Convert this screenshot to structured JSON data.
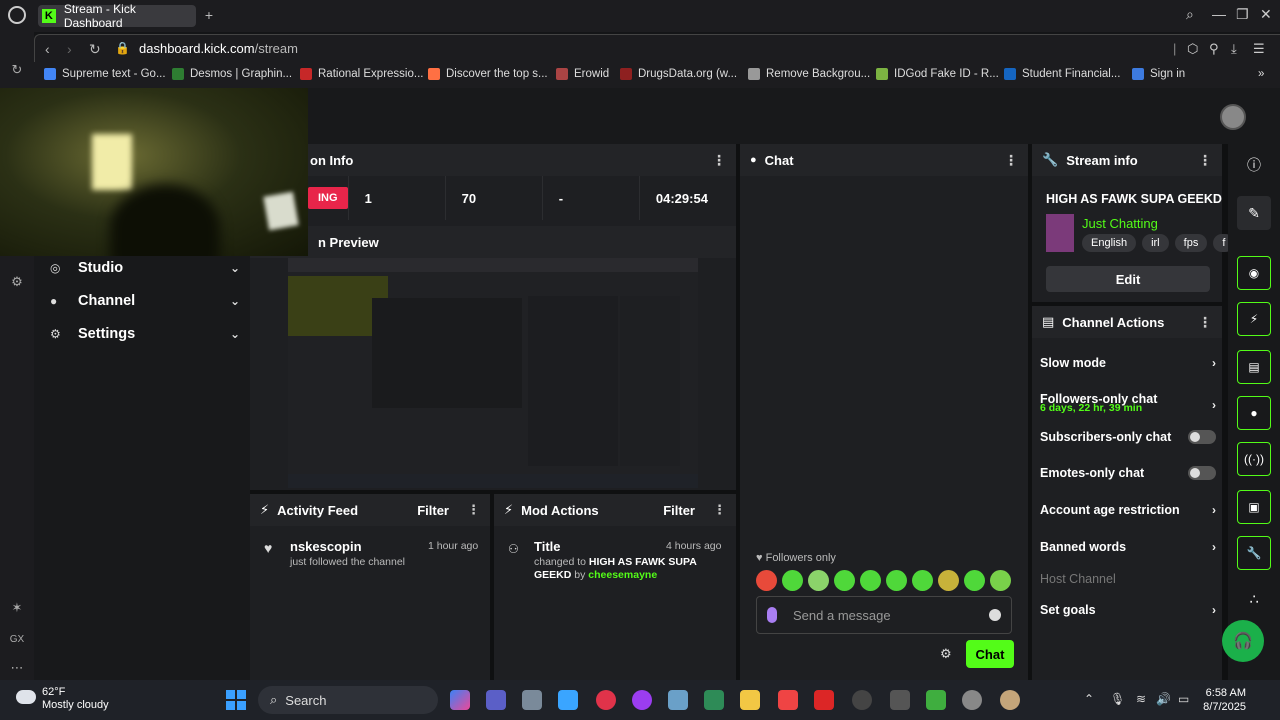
{
  "browser": {
    "tab_title": "Stream - Kick Dashboard",
    "url_host": "dashboard.kick.com",
    "url_path": "/stream",
    "bookmarks": [
      "Supreme text - Go...",
      "Desmos | Graphin...",
      "Rational Expressio...",
      "Discover the top s...",
      "Erowid",
      "DrugsData.org (w...",
      "Remove Backgrou...",
      "IDGod Fake ID - R...",
      "Student Financial...",
      "Sign in"
    ],
    "sidebar_bottom_label": "GX"
  },
  "nav": {
    "items": [
      {
        "label": "Studio"
      },
      {
        "label": "Channel"
      },
      {
        "label": "Settings"
      }
    ]
  },
  "session": {
    "header": "on Info",
    "live_label": "ING",
    "stats": [
      "1",
      "70",
      "-",
      "04:29:54"
    ]
  },
  "preview": {
    "header": "n Preview"
  },
  "chat": {
    "header": "Chat",
    "followers_only": "Followers only",
    "input_placeholder": "Send a message",
    "send_label": "Chat"
  },
  "stream_info": {
    "header": "Stream info",
    "title": "HIGH AS FAWK SUPA GEEKD",
    "category": "Just Chatting",
    "tags": [
      "English",
      "irl",
      "fps",
      "f"
    ],
    "edit_label": "Edit"
  },
  "channel_actions": {
    "header": "Channel Actions",
    "rows": [
      {
        "label": "Slow mode"
      },
      {
        "label": "Followers-only chat",
        "sub": "6 days, 22 hr, 39 min"
      },
      {
        "label": "Subscribers-only chat"
      },
      {
        "label": "Emotes-only chat"
      },
      {
        "label": "Account age restriction"
      },
      {
        "label": "Banned words"
      },
      {
        "label": "Host Channel"
      },
      {
        "label": "Set goals"
      }
    ]
  },
  "activity_feed": {
    "header": "Activity Feed",
    "filter": "Filter",
    "item_name": "nskescopin",
    "item_time": "1 hour ago",
    "item_sub": "just followed the channel"
  },
  "mod_actions": {
    "header": "Mod Actions",
    "filter": "Filter",
    "item_name": "Title",
    "item_time": "4 hours ago",
    "item_sub_prefix": "changed to",
    "item_sub_title": "HIGH AS FAWK SUPA GEEKD",
    "item_sub_by": "by",
    "item_sub_user": "cheesemayne"
  },
  "taskbar": {
    "temp": "62°F",
    "weather": "Mostly cloudy",
    "search": "Search",
    "time": "6:58 AM",
    "date": "8/7/2025"
  },
  "colors": {
    "accent": "#53fc18",
    "live": "#e8254a",
    "bg": "#0f1011"
  }
}
